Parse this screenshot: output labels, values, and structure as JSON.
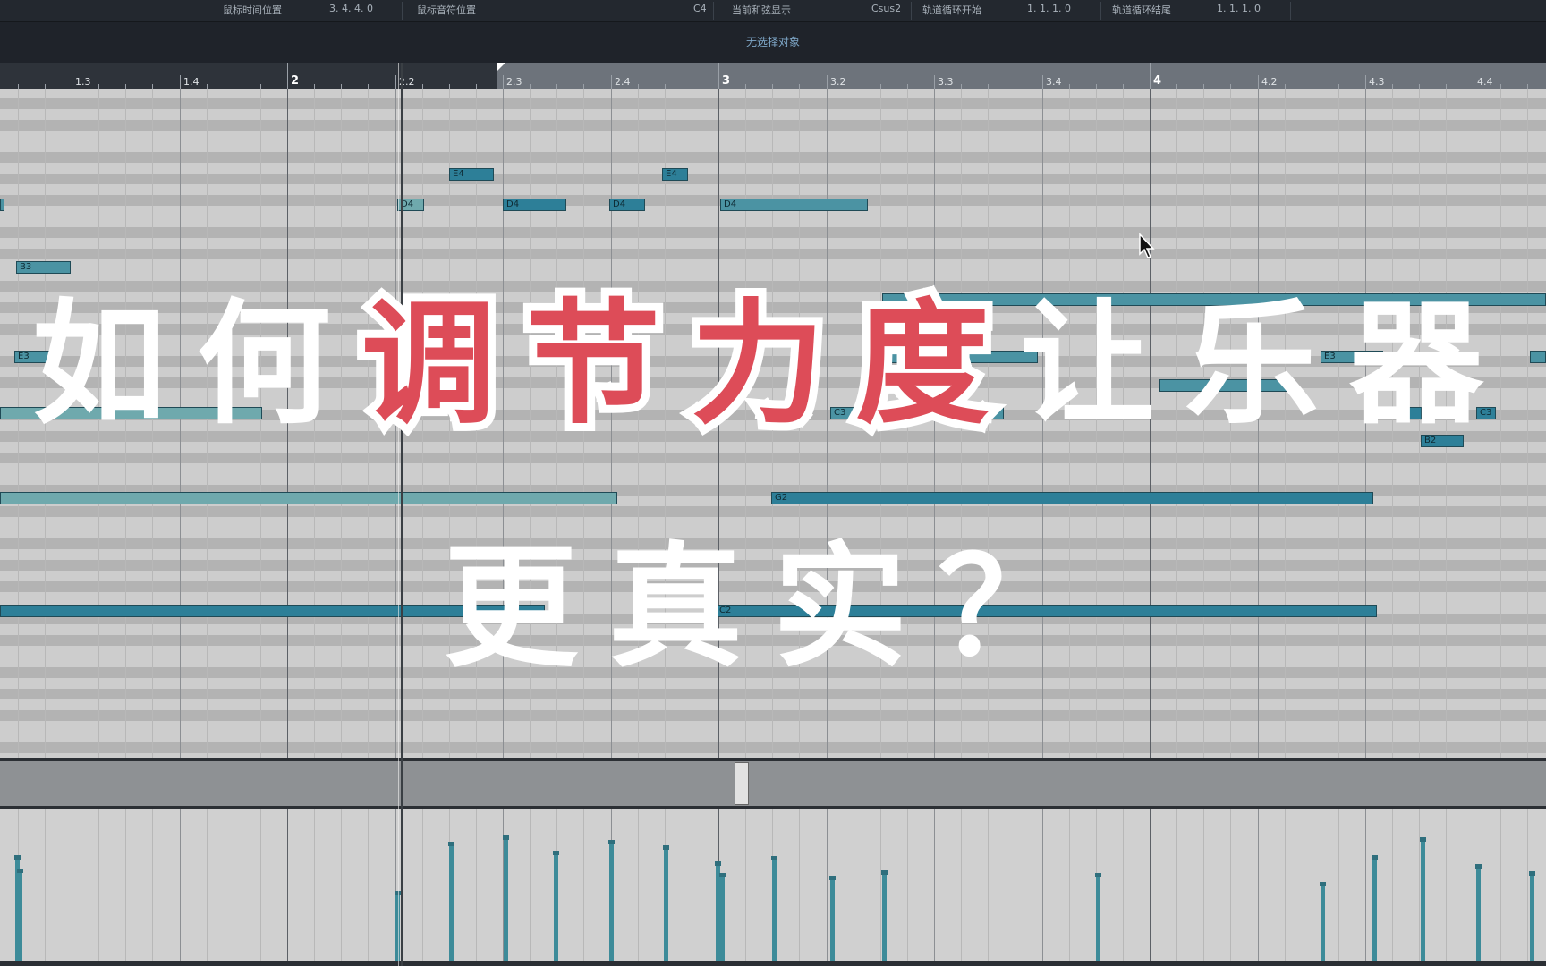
{
  "infobar": {
    "mouse_time_label": "鼠标时间位置",
    "mouse_time_value": "3. 4. 4.   0",
    "mouse_pitch_label": "鼠标音符位置",
    "mouse_pitch_value": "C4",
    "chord_label": "当前和弦显示",
    "chord_value": "Csus2",
    "loop_start_label": "轨道循环开始",
    "loop_start_value": "1.  1.  1.   0",
    "loop_end_label": "轨道循环结尾",
    "loop_end_value": "1.  1.  1.   0"
  },
  "status": {
    "text": "无选择对象"
  },
  "ruler": {
    "ticks": [
      "1.3",
      "1.4",
      "2",
      "2.2",
      "2.3",
      "2.4",
      "3",
      "3.2",
      "3.3",
      "3.4",
      "4",
      "4.2",
      "4.3",
      "4.4"
    ]
  },
  "notes": [
    "E4",
    "E4",
    "D4",
    "D4",
    "D4",
    "D4",
    "B3",
    "E3",
    "E3",
    "C3",
    "C3",
    "C3",
    "B2",
    "G2",
    "C2"
  ],
  "title": {
    "line1_part1": "如何",
    "line1_part2": "调节力度",
    "line1_part3": "让乐器",
    "line2": "更真实？"
  },
  "colors": {
    "note_fill": "#4b93a3",
    "title_red": "#dd4c58",
    "grid_bg": "#c8c8c8"
  },
  "icons": {
    "cursor": "arrow-cursor-icon",
    "loop": "loop-flag-icon"
  }
}
